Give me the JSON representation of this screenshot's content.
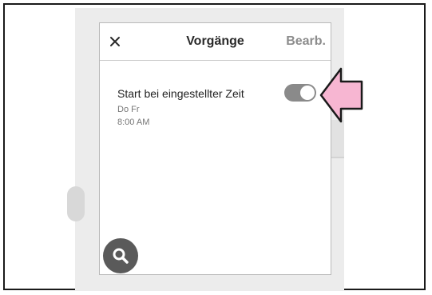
{
  "dialog": {
    "title": "Vorgänge",
    "edit_label": "Bearb."
  },
  "schedule_item": {
    "label": "Start bei eingestellter Zeit",
    "days": "Do Fr",
    "time": "8:00 AM",
    "enabled": true
  },
  "icons": {
    "close": "close-icon",
    "search": "search-icon",
    "pointer": "arrow-left-icon"
  },
  "colors": {
    "toggle_on": "#8a8a8a",
    "fab": "#5a5a5a",
    "pointer_fill": "#f7b6d2",
    "title_text": "#2a2a2a",
    "edit_text": "#8c8c8c"
  }
}
